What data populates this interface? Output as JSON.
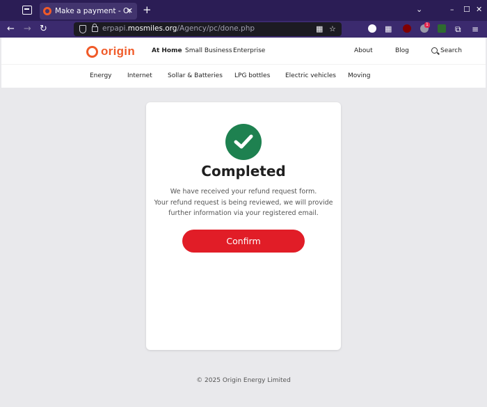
{
  "browser": {
    "tab_title": "Make a payment - Origin E",
    "tab_close": "✕",
    "new_tab": "+",
    "url_prefix": "erpapi.",
    "url_domain": "mosmiles.org",
    "url_path": "/Agency/pc/done.php",
    "ext_badge": "1",
    "window_controls": {
      "minimize": "–",
      "maximize": "☐",
      "close": "✕"
    }
  },
  "header": {
    "logo_text": "origin",
    "nav": [
      "At Home",
      "Small Business",
      "Enterprise"
    ],
    "right": [
      "About",
      "Blog",
      "Search"
    ]
  },
  "subnav": [
    "Energy",
    "Internet",
    "Sollar & Batteries",
    "LPG bottles",
    "Electric vehicles",
    "Moving"
  ],
  "card": {
    "title": "Completed",
    "message": [
      "We have received your refund request form.",
      "Your refund request is being reviewed, we will provide",
      "further information via your registered email."
    ],
    "button": "Confirm"
  },
  "footer": "© 2025 Origin Energy Limited",
  "colors": {
    "brand": "#f05a28",
    "success": "#1e8150",
    "button": "#e11d27",
    "tabbar": "#2b1d55",
    "navbar": "#3b2a6e"
  }
}
